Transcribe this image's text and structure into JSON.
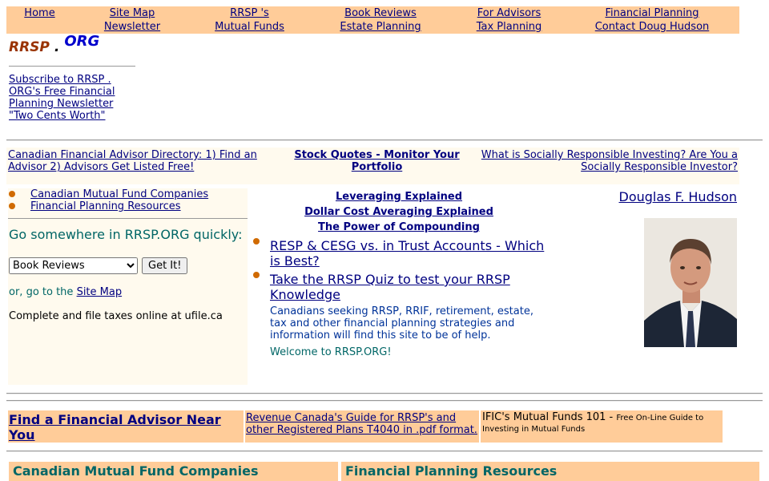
{
  "nav": {
    "columns": [
      {
        "top": "Home",
        "bottom": ""
      },
      {
        "top": "Site Map",
        "bottom": "Newsletter"
      },
      {
        "top": "RRSP 's",
        "bottom": "Mutual Funds"
      },
      {
        "top": "Book Reviews",
        "bottom": "Estate Planning"
      },
      {
        "top": "For Advisors",
        "bottom": "Tax Planning"
      },
      {
        "top": "Financial Planning",
        "bottom": "Contact Doug Hudson"
      }
    ]
  },
  "logo": {
    "part1": "RRSP",
    "dot": ".",
    "part2": "ORG"
  },
  "subscribe_link": "Subscribe to RRSP . ORG's Free Financial Planning Newsletter \"Two Cents Worth\"",
  "strip": {
    "left": "Canadian Financial Advisor Directory: 1) Find an Advisor 2) Advisors Get Listed Free!",
    "middle": "Stock Quotes - Monitor Your Portfolio",
    "right": "What is Socially Responsible Investing? Are You a Socially Responsible Investor?"
  },
  "left_panel": {
    "links": [
      "Canadian Mutual Fund Companies",
      "Financial Planning Resources"
    ],
    "go_label": "Go somewhere in RRSP.ORG quickly:",
    "select_value": "Book Reviews",
    "go_button": "Get It!",
    "sitemap_prefix": "or, go to the ",
    "sitemap_link": "Site Map",
    "ufile_text": "Complete and file taxes online at ufile.ca"
  },
  "center": {
    "links": [
      "Leveraging Explained",
      "Dollar Cost Averaging Explained",
      "The Power of Compounding"
    ],
    "big_items": [
      "RESP & CESG vs. in Trust Accounts - Which is Best?",
      "Take the RRSP Quiz to test your RRSP Knowledge"
    ],
    "description": "Canadians seeking RRSP, RRIF, retirement, estate, tax and other financial planning strategies and information will find this site to be of help.",
    "welcome": "Welcome to RRSP.ORG!"
  },
  "right": {
    "author_link": "Douglas F. Hudson"
  },
  "lower_row": {
    "cell1": "Find a Financial Advisor Near You",
    "cell2": "Revenue Canada's Guide for RRSP's and other Registered Plans T4040 in .pdf format.",
    "cell3_title": "IFIC's Mutual Funds 101 - ",
    "cell3_small": "Free On-Line Guide to Investing in Mutual Funds"
  },
  "sections": [
    "Canadian Mutual Fund Companies",
    "Financial Planning Resources"
  ],
  "colors": {
    "nav_bg": "#ffcc99",
    "panel_bg": "#fffaee",
    "link": "#000080",
    "teal": "#006666",
    "bullet": "#d06a00",
    "logo_brown": "#993300",
    "logo_blue": "#0000cc"
  }
}
